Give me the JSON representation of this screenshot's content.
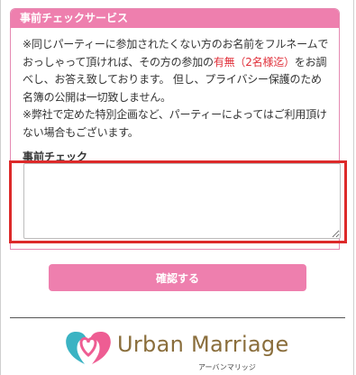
{
  "service": {
    "title": "事前チェックサービス",
    "desc_p1_before": "※同じパーティーに参加されたくない方のお名前をフルネームでおっしゃって頂ければ、その方の参加の",
    "desc_p1_red": "有無（2名様迄）",
    "desc_p1_after": "をお調べし、お答え致しております。 但し、プライバシー保護のため名簿の公開は一切致しません。",
    "desc_p2": "※弊社で定めた特別企画など、パーティーによってはご利用頂けない場合もございます。",
    "field_label": "事前チェック",
    "textarea_value": ""
  },
  "confirm_button_label": "確認する",
  "logo": {
    "text": "Urban Marriage",
    "subtext": "アーバンマリッジ"
  },
  "colors": {
    "accent_pink": "#ee7fae",
    "highlight_red": "#dd2a2a",
    "logo_teal": "#3bb3c3",
    "logo_pink": "#ee5d93",
    "logo_brown": "#8a6e3c"
  }
}
